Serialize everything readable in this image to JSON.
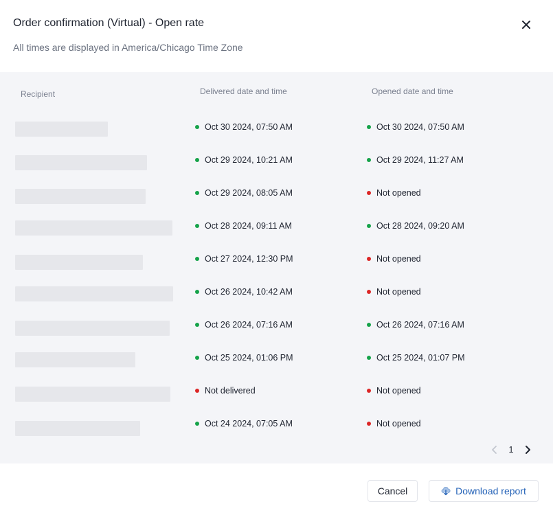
{
  "modal": {
    "title": "Order confirmation (Virtual) - Open rate",
    "subtitle": "All times are displayed in America/Chicago Time Zone"
  },
  "table": {
    "columns": {
      "recipient": "Recipient",
      "delivered": "Delivered date and time",
      "opened": "Opened date and time"
    },
    "rows": [
      {
        "delivered": "Oct 30 2024, 07:50 AM",
        "delivered_status": "success",
        "opened": "Oct 30 2024, 07:50 AM",
        "opened_status": "success"
      },
      {
        "delivered": "Oct 29 2024, 10:21 AM",
        "delivered_status": "success",
        "opened": "Oct 29 2024, 11:27 AM",
        "opened_status": "success"
      },
      {
        "delivered": "Oct 29 2024, 08:05 AM",
        "delivered_status": "success",
        "opened": "Not opened",
        "opened_status": "error"
      },
      {
        "delivered": "Oct 28 2024, 09:11 AM",
        "delivered_status": "success",
        "opened": "Oct 28 2024, 09:20 AM",
        "opened_status": "success"
      },
      {
        "delivered": "Oct 27 2024, 12:30 PM",
        "delivered_status": "success",
        "opened": "Not opened",
        "opened_status": "error"
      },
      {
        "delivered": "Oct 26 2024, 10:42 AM",
        "delivered_status": "success",
        "opened": "Not opened",
        "opened_status": "error"
      },
      {
        "delivered": "Oct 26 2024, 07:16 AM",
        "delivered_status": "success",
        "opened": "Oct 26 2024, 07:16 AM",
        "opened_status": "success"
      },
      {
        "delivered": "Oct 25 2024, 01:06 PM",
        "delivered_status": "success",
        "opened": "Oct 25 2024, 01:07 PM",
        "opened_status": "success"
      },
      {
        "delivered": "Not delivered",
        "delivered_status": "error",
        "opened": "Not opened",
        "opened_status": "error"
      },
      {
        "delivered": "Oct 24 2024, 07:05 AM",
        "delivered_status": "success",
        "opened": "Not opened",
        "opened_status": "error"
      }
    ]
  },
  "pagination": {
    "current_page": "1"
  },
  "footer": {
    "cancel_label": "Cancel",
    "download_label": "Download report"
  },
  "icons": {
    "close": "close-icon",
    "prev": "chevron-left-icon",
    "next": "chevron-right-icon",
    "download": "cloud-download-icon"
  },
  "colors": {
    "success": "#16a34a",
    "error": "#dc2626",
    "accent": "#2563b8",
    "table_background": "#f4f5f8"
  }
}
